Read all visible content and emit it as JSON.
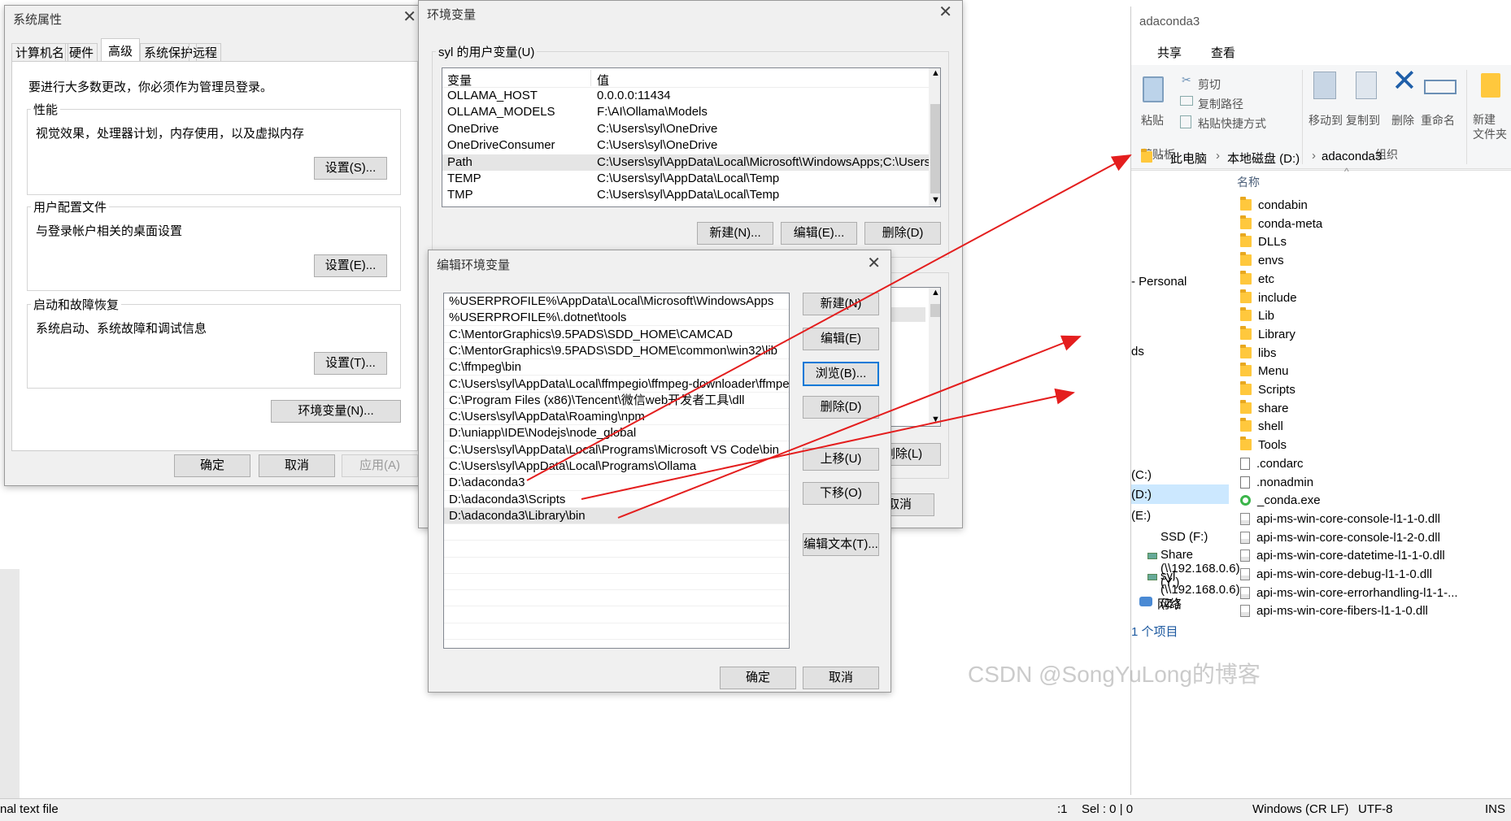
{
  "colors": {
    "accent": "#0078d7",
    "arrow": "#e41e1e",
    "folder": "#ffc83d"
  },
  "bg_editor": {
    "status_left": "nal text file",
    "status_right": {
      "pos": ":1",
      "sel": "Sel : 0 | 0",
      "eol": "Windows (CR LF)",
      "enc": "UTF-8",
      "mode": "INS"
    }
  },
  "sysprop": {
    "title": "系统属性",
    "tabs": [
      "计算机名",
      "硬件",
      "高级",
      "系统保护",
      "远程"
    ],
    "admin_note": "要进行大多数更改，你必须作为管理员登录。",
    "perf": {
      "label": "性能",
      "desc": "视觉效果，处理器计划，内存使用，以及虚拟内存",
      "btn": "设置(S)..."
    },
    "profile": {
      "label": "用户配置文件",
      "desc": "与登录帐户相关的桌面设置",
      "btn": "设置(E)..."
    },
    "startup": {
      "label": "启动和故障恢复",
      "desc": "系统启动、系统故障和调试信息",
      "btn": "设置(T)..."
    },
    "env_btn": "环境变量(N)...",
    "ok": "确定",
    "cancel": "取消",
    "apply": "应用(A)"
  },
  "envvars": {
    "title": "环境变量",
    "user_label": "syl 的用户变量(U)",
    "col_var": "变量",
    "col_val": "值",
    "rows": [
      {
        "name": "OLLAMA_HOST",
        "value": "0.0.0.0:11434"
      },
      {
        "name": "OLLAMA_MODELS",
        "value": "F:\\AI\\Ollama\\Models"
      },
      {
        "name": "OneDrive",
        "value": "C:\\Users\\syl\\OneDrive"
      },
      {
        "name": "OneDriveConsumer",
        "value": "C:\\Users\\syl\\OneDrive"
      },
      {
        "name": "Path",
        "value": "C:\\Users\\syl\\AppData\\Local\\Microsoft\\WindowsApps;C:\\Users\\..."
      },
      {
        "name": "TEMP",
        "value": "C:\\Users\\syl\\AppData\\Local\\Temp"
      },
      {
        "name": "TMP",
        "value": "C:\\Users\\syl\\AppData\\Local\\Temp"
      }
    ],
    "new": "新建(N)...",
    "edit": "编辑(E)...",
    "delete": "删除(D)",
    "sys_delete": "删除(L)",
    "cancel_partial": "取消"
  },
  "editenv": {
    "title": "编辑环境变量",
    "paths": [
      "%USERPROFILE%\\AppData\\Local\\Microsoft\\WindowsApps",
      "%USERPROFILE%\\.dotnet\\tools",
      "C:\\MentorGraphics\\9.5PADS\\SDD_HOME\\CAMCAD",
      "C:\\MentorGraphics\\9.5PADS\\SDD_HOME\\common\\win32\\lib",
      "C:\\ffmpeg\\bin",
      "C:\\Users\\syl\\AppData\\Local\\ffmpegio\\ffmpeg-downloader\\ffmpe...",
      "C:\\Program Files (x86)\\Tencent\\微信web开发者工具\\dll",
      "C:\\Users\\syl\\AppData\\Roaming\\npm",
      "D:\\uniapp\\IDE\\Nodejs\\node_global",
      "C:\\Users\\syl\\AppData\\Local\\Programs\\Microsoft VS Code\\bin",
      "C:\\Users\\syl\\AppData\\Local\\Programs\\Ollama",
      "D:\\adaconda3",
      "D:\\adaconda3\\Scripts",
      "D:\\adaconda3\\Library\\bin"
    ],
    "new": "新建(N)",
    "edit": "编辑(E)",
    "browse": "浏览(B)...",
    "delete": "删除(D)",
    "up": "上移(U)",
    "down": "下移(O)",
    "edit_text": "编辑文本(T)...",
    "ok": "确定",
    "cancel": "取消"
  },
  "explorer": {
    "title": "adaconda3",
    "ribbon_tabs": [
      "共享",
      "查看"
    ],
    "clipboard": {
      "paste": "粘贴",
      "cut": "剪切",
      "copy_path": "复制路径",
      "paste_shortcut": "粘贴快捷方式",
      "group": "剪贴板"
    },
    "organize": {
      "move_to": "移动到",
      "copy_to": "复制到",
      "delete": "删除",
      "rename": "重命名",
      "group": "组织"
    },
    "new_folder": "新建\n文件夹",
    "breadcrumb": [
      "此电脑",
      "本地磁盘 (D:)",
      "adaconda3"
    ],
    "col_name": "名称",
    "nav": [
      "- Personal",
      "ds",
      "(C:)",
      "(D:)",
      "(E:)",
      "SSD (F:)",
      "Share (\\\\192.168.0.6) (Y:)",
      "syl (\\\\192.168.0.6) (Z:)",
      "网络"
    ],
    "status": "1 个项目",
    "folders": [
      "condabin",
      "conda-meta",
      "DLLs",
      "envs",
      "etc",
      "include",
      "Lib",
      "Library",
      "libs",
      "Menu",
      "Scripts",
      "share",
      "shell",
      "Tools"
    ],
    "files": [
      ".condarc",
      ".nonadmin"
    ],
    "exe": "_conda.exe",
    "dlls": [
      "api-ms-win-core-console-l1-1-0.dll",
      "api-ms-win-core-console-l1-2-0.dll",
      "api-ms-win-core-datetime-l1-1-0.dll",
      "api-ms-win-core-debug-l1-1-0.dll",
      "api-ms-win-core-errorhandling-l1-1-...",
      "api-ms-win-core-fibers-l1-1-0.dll"
    ]
  },
  "watermark": "CSDN @SongYuLong的博客"
}
